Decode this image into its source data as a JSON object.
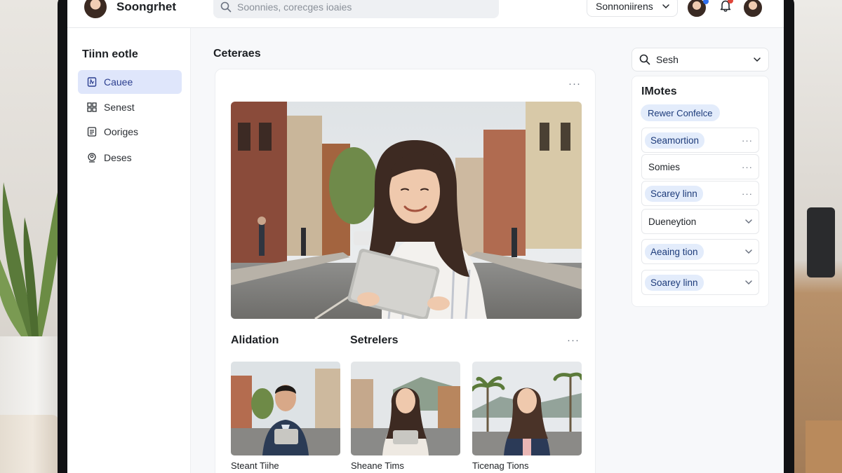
{
  "app": {
    "brand_name": "Soongrhet"
  },
  "search": {
    "placeholder": "Soonnies, corecges ioaies"
  },
  "header": {
    "account_select_label": "Sonnoniirens"
  },
  "sidebar": {
    "title": "Tiinn eotle",
    "items": [
      {
        "label": "Cauee",
        "icon": "document-icon",
        "active": true
      },
      {
        "label": "Senest",
        "icon": "grid-icon",
        "active": false
      },
      {
        "label": "Ooriges",
        "icon": "list-icon",
        "active": false
      },
      {
        "label": "Deses",
        "icon": "user-badge-icon",
        "active": false
      }
    ]
  },
  "main": {
    "title": "Ceteraes",
    "hero_image": "woman-holding-tablet-street-photo",
    "sections": {
      "left_label": "Alidation",
      "right_label": "Setrelers"
    },
    "thumbnails": [
      {
        "caption": "Steant Tiihe",
        "image": "man-with-tablet-street-photo"
      },
      {
        "caption": "Sheane Tims",
        "image": "woman-with-tablet-street-photo"
      },
      {
        "caption": "Ticenag Tions",
        "image": "woman-palm-trees-photo"
      }
    ]
  },
  "right_panel": {
    "search_select_label": "Sesh",
    "title": "IMotes",
    "chip_label": "Rewer Confelce",
    "rows": [
      {
        "label": "Seamortion",
        "pill": true,
        "control": "more"
      },
      {
        "label": "Somies",
        "pill": false,
        "control": "more"
      },
      {
        "label": "Scarey linn",
        "pill": true,
        "control": "more"
      },
      {
        "label": "Dueneytion",
        "pill": false,
        "control": "chevron"
      },
      {
        "label": "Aeaing tion",
        "pill": true,
        "control": "chevron"
      },
      {
        "label": "Soarey linn",
        "pill": true,
        "control": "chevron"
      }
    ]
  },
  "colors": {
    "accent": "#dfe6fb",
    "chip": "#e3ecfb",
    "chip_text": "#1d3b7a",
    "notification": "#e0463a",
    "online": "#2f6fed"
  }
}
